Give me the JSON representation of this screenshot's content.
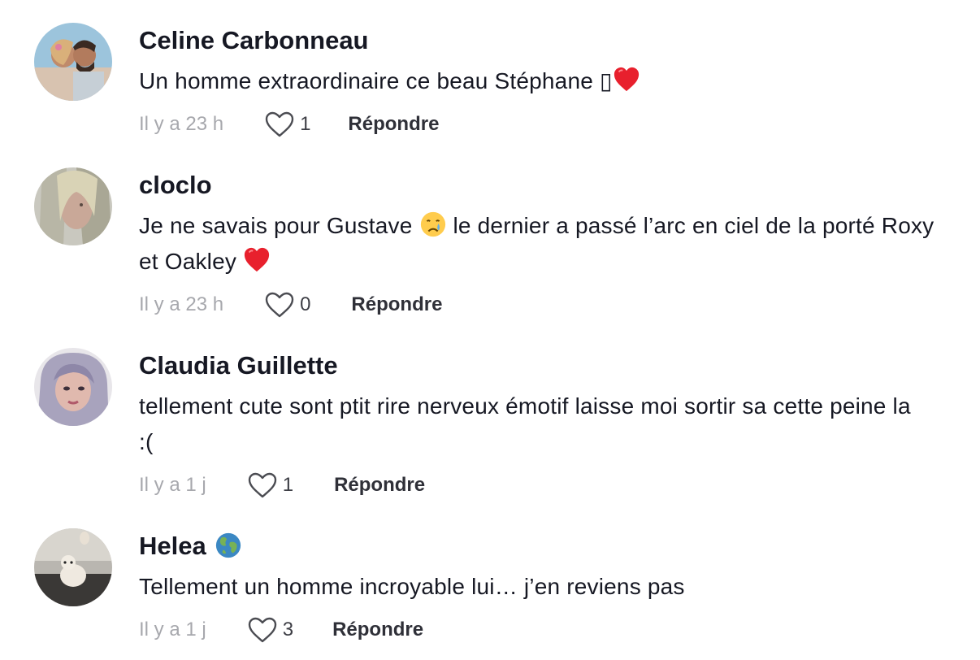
{
  "comments": [
    {
      "username": "Celine Carbonneau",
      "text": "Un homme extraordinaire ce beau Stéphane",
      "emoji_suffix": "▯",
      "time": "Il y a 23 h",
      "likes": "1",
      "reply_label": "Répondre"
    },
    {
      "username": "cloclo",
      "text_part1": "Je ne savais pour Gustave",
      "text_part2": "le dernier a passé l’arc en ciel de la porté Roxy et Oakley",
      "time": "Il y a 23 h",
      "likes": "0",
      "reply_label": "Répondre"
    },
    {
      "username": "Claudia Guillette",
      "text": "tellement cute sont ptit rire nerveux émotif laisse moi sortir sa cette peine la :(",
      "time": "Il y a 1 j",
      "likes": "1",
      "reply_label": "Répondre"
    },
    {
      "username": "Helea",
      "text": "Tellement un homme incroyable lui… j’en reviens pas",
      "time": "Il y a 1 j",
      "likes": "3",
      "reply_label": "Répondre"
    }
  ],
  "colors": {
    "text": "#161823",
    "muted": "#a7a8ad",
    "heart_red": "#e8202d"
  },
  "icons": [
    "heart-outline-icon",
    "red-heart-emoji",
    "crying-face-emoji",
    "globe-emoji"
  ]
}
